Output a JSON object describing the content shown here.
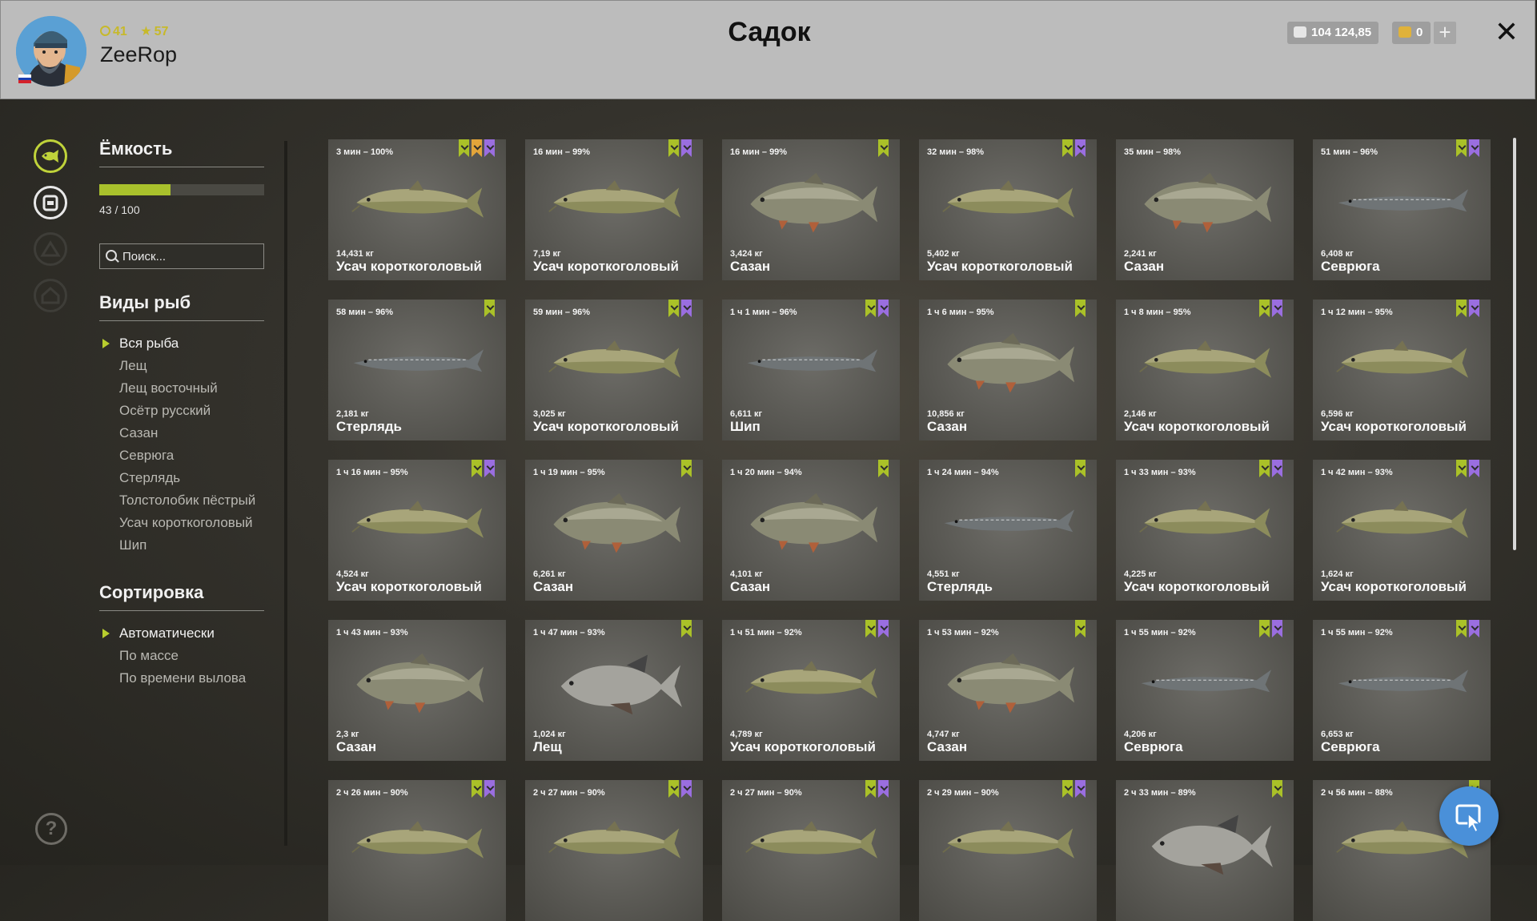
{
  "header": {
    "title": "Садок",
    "username": "ZeeRop",
    "level": "41",
    "rank": "57",
    "silver": "104 124,85",
    "gold": "0",
    "plus_label": "+",
    "close_label": "✕"
  },
  "capacity": {
    "title": "Ёмкость",
    "used": 43,
    "total": 100,
    "fill_fraction": 0.43,
    "text": "43 / 100"
  },
  "search": {
    "placeholder": "Поиск..."
  },
  "species_filter": {
    "title": "Виды рыб",
    "items": [
      {
        "label": "Вся рыба",
        "selected": true
      },
      {
        "label": "Лещ"
      },
      {
        "label": "Лещ восточный"
      },
      {
        "label": "Осётр русский"
      },
      {
        "label": "Сазан"
      },
      {
        "label": "Севрюга"
      },
      {
        "label": "Стерлядь"
      },
      {
        "label": "Толстолобик пёстрый"
      },
      {
        "label": "Усач короткоголовый"
      },
      {
        "label": "Шип"
      }
    ]
  },
  "sort": {
    "title": "Сортировка",
    "items": [
      {
        "label": "Автоматически",
        "selected": true
      },
      {
        "label": "По массе"
      },
      {
        "label": "По времени вылова"
      }
    ]
  },
  "help_label": "?",
  "colors": {
    "accent": "#a9c12c",
    "badge_green": "#aac128",
    "badge_purple": "#9a6ee0",
    "badge_gold": "#e3a53a"
  },
  "fish": [
    {
      "time": "3 мин – 100%",
      "weight": "14,431 кг",
      "name": "Усач короткоголовый",
      "badges": [
        "g",
        "o",
        "p"
      ],
      "shape": "barbel"
    },
    {
      "time": "16 мин – 99%",
      "weight": "7,19 кг",
      "name": "Усач короткоголовый",
      "badges": [
        "g",
        "p"
      ],
      "shape": "barbel"
    },
    {
      "time": "16 мин – 99%",
      "weight": "3,424 кг",
      "name": "Сазан",
      "badges": [
        "g"
      ],
      "shape": "carp"
    },
    {
      "time": "32 мин – 98%",
      "weight": "5,402 кг",
      "name": "Усач короткоголовый",
      "badges": [
        "g",
        "p"
      ],
      "shape": "barbel"
    },
    {
      "time": "35 мин – 98%",
      "weight": "2,241 кг",
      "name": "Сазан",
      "badges": [],
      "shape": "carp"
    },
    {
      "time": "51 мин – 96%",
      "weight": "6,408 кг",
      "name": "Севрюга",
      "badges": [
        "g",
        "p"
      ],
      "shape": "sturgeon"
    },
    {
      "time": "58 мин – 96%",
      "weight": "2,181 кг",
      "name": "Стерлядь",
      "badges": [
        "g"
      ],
      "shape": "sturgeon"
    },
    {
      "time": "59 мин – 96%",
      "weight": "3,025 кг",
      "name": "Усач короткоголовый",
      "badges": [
        "g",
        "p"
      ],
      "shape": "barbel"
    },
    {
      "time": "1 ч 1 мин – 96%",
      "weight": "6,611 кг",
      "name": "Шип",
      "badges": [
        "g",
        "p"
      ],
      "shape": "sturgeon"
    },
    {
      "time": "1 ч 6 мин – 95%",
      "weight": "10,856 кг",
      "name": "Сазан",
      "badges": [
        "g"
      ],
      "shape": "carp"
    },
    {
      "time": "1 ч 8 мин – 95%",
      "weight": "2,146 кг",
      "name": "Усач короткоголовый",
      "badges": [
        "g",
        "p"
      ],
      "shape": "barbel"
    },
    {
      "time": "1 ч 12 мин – 95%",
      "weight": "6,596 кг",
      "name": "Усач короткоголовый",
      "badges": [
        "g",
        "p"
      ],
      "shape": "barbel"
    },
    {
      "time": "1 ч 16 мин – 95%",
      "weight": "4,524 кг",
      "name": "Усач короткоголовый",
      "badges": [
        "g",
        "p"
      ],
      "shape": "barbel"
    },
    {
      "time": "1 ч 19 мин – 95%",
      "weight": "6,261 кг",
      "name": "Сазан",
      "badges": [
        "g"
      ],
      "shape": "carp"
    },
    {
      "time": "1 ч 20 мин – 94%",
      "weight": "4,101 кг",
      "name": "Сазан",
      "badges": [
        "g"
      ],
      "shape": "carp"
    },
    {
      "time": "1 ч 24 мин – 94%",
      "weight": "4,551 кг",
      "name": "Стерлядь",
      "badges": [
        "g"
      ],
      "shape": "sturgeon"
    },
    {
      "time": "1 ч 33 мин – 93%",
      "weight": "4,225 кг",
      "name": "Усач короткоголовый",
      "badges": [
        "g",
        "p"
      ],
      "shape": "barbel"
    },
    {
      "time": "1 ч 42 мин – 93%",
      "weight": "1,624 кг",
      "name": "Усач короткоголовый",
      "badges": [
        "g",
        "p"
      ],
      "shape": "barbel"
    },
    {
      "time": "1 ч 43 мин – 93%",
      "weight": "2,3 кг",
      "name": "Сазан",
      "badges": [],
      "shape": "carp"
    },
    {
      "time": "1 ч 47 мин – 93%",
      "weight": "1,024 кг",
      "name": "Лещ",
      "badges": [
        "g"
      ],
      "shape": "bream"
    },
    {
      "time": "1 ч 51 мин – 92%",
      "weight": "4,789 кг",
      "name": "Усач короткоголовый",
      "badges": [
        "g",
        "p"
      ],
      "shape": "barbel"
    },
    {
      "time": "1 ч 53 мин – 92%",
      "weight": "4,747 кг",
      "name": "Сазан",
      "badges": [
        "g"
      ],
      "shape": "carp"
    },
    {
      "time": "1 ч 55 мин – 92%",
      "weight": "4,206 кг",
      "name": "Севрюга",
      "badges": [
        "g",
        "p"
      ],
      "shape": "sturgeon"
    },
    {
      "time": "1 ч 55 мин – 92%",
      "weight": "6,653 кг",
      "name": "Севрюга",
      "badges": [
        "g",
        "p"
      ],
      "shape": "sturgeon"
    },
    {
      "time": "2 ч 26 мин – 90%",
      "weight": "",
      "name": "",
      "badges": [
        "g",
        "p"
      ],
      "shape": "barbel"
    },
    {
      "time": "2 ч 27 мин – 90%",
      "weight": "",
      "name": "",
      "badges": [
        "g",
        "p"
      ],
      "shape": "barbel"
    },
    {
      "time": "2 ч 27 мин – 90%",
      "weight": "",
      "name": "",
      "badges": [
        "g",
        "p"
      ],
      "shape": "barbel"
    },
    {
      "time": "2 ч 29 мин – 90%",
      "weight": "",
      "name": "",
      "badges": [
        "g",
        "p"
      ],
      "shape": "barbel"
    },
    {
      "time": "2 ч 33 мин – 89%",
      "weight": "",
      "name": "",
      "badges": [
        "g"
      ],
      "shape": "bream"
    },
    {
      "time": "2 ч 56 мин – 88%",
      "weight": "",
      "name": "",
      "badges": [
        "g"
      ],
      "shape": "barbel"
    }
  ]
}
